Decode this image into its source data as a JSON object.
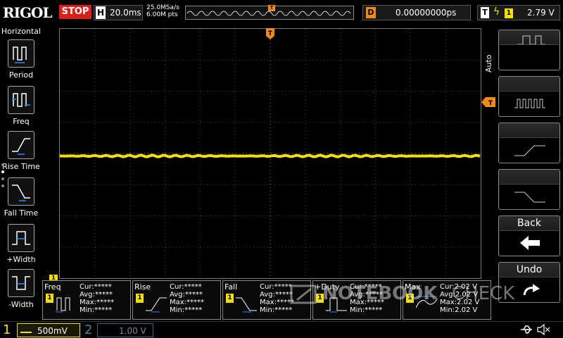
{
  "topbar": {
    "logo": "RIGOL",
    "run_state": "STOP",
    "timebase_tag": "H",
    "timebase_value": "20.0ms",
    "sample_rate": "25.0MSa/s",
    "memory_depth": "6.00M pts",
    "memory_trigger_tag": "T",
    "delay_tag": "D",
    "delay_value": "0.00000000ps",
    "trigger_tag": "T",
    "trigger_edge": "ϟ",
    "trigger_source": "1",
    "trigger_level": "2.79 V"
  },
  "left_menu": {
    "title": "Horizontal",
    "items": [
      {
        "label": "Period",
        "icon": "period-icon"
      },
      {
        "label": "Freq",
        "icon": "freq-icon"
      },
      {
        "label": "Rise Time",
        "icon": "rise-time-icon"
      },
      {
        "label": "Fall Time",
        "icon": "fall-time-icon"
      },
      {
        "label": "+Width",
        "icon": "pos-width-icon"
      },
      {
        "label": "-Width",
        "icon": "neg-width-icon"
      }
    ]
  },
  "grid": {
    "trigger_marker": "T",
    "trigger_level_marker": "T",
    "channel_marker": "1",
    "trace_color": "#f5e100",
    "trace_level": 0.49
  },
  "right_menu": {
    "title": "Auto",
    "buttons": [
      {
        "label": "",
        "icon": "single-pulse-icon"
      },
      {
        "label": "",
        "icon": "pulse-train-icon"
      },
      {
        "label": "",
        "icon": "rising-edge-icon"
      },
      {
        "label": "",
        "icon": "falling-edge-icon"
      },
      {
        "label": "Back",
        "icon": "left-arrow-icon"
      },
      {
        "label": "Undo",
        "icon": "undo-icon"
      }
    ]
  },
  "measurements": [
    {
      "name": "Freq",
      "channel": "1",
      "cur": "Cur:*****",
      "avg": "Avg:*****",
      "max": "Max:*****",
      "min": "Min:*****"
    },
    {
      "name": "Rise",
      "channel": "1",
      "cur": "Cur:*****",
      "avg": "Avg:*****",
      "max": "Max:*****",
      "min": "Min:*****"
    },
    {
      "name": "Fall",
      "channel": "1",
      "cur": "Cur:*****",
      "avg": "Avg:*****",
      "max": "Max:*****",
      "min": "Min:*****"
    },
    {
      "name": "+Duty",
      "channel": "1",
      "cur": "Cur:*****",
      "avg": "Avg:*****",
      "max": "Max:*****",
      "min": "Min:*****"
    },
    {
      "name": "Max",
      "channel": "1",
      "cur": "Cur:2.02 V",
      "avg": "Avg:2.02 V",
      "max": "Max:2.02 V",
      "min": "Min:2.02 V"
    }
  ],
  "watermark": {
    "brand": "NOTEBOOK",
    "suffix": "CHECK"
  },
  "bottombar": {
    "ch1_number": "1",
    "ch1_scale": "500mV",
    "ch2_number": "2",
    "ch2_scale": "1.00 V",
    "usb_icon": "usb-icon",
    "speaker_icon": "speaker-mute-icon"
  },
  "colors": {
    "ch1": "#f5e100",
    "ch2": "#2a6a7a",
    "trigger": "#f08a1c",
    "stop": "#d8211a"
  }
}
